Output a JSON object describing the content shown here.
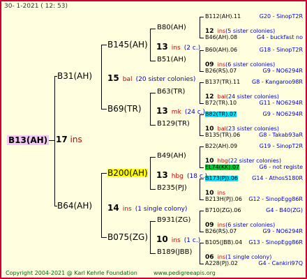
{
  "header": {
    "date": "30-  1-2021  ( 12:  53)"
  },
  "footer": {
    "copyright": "Copyright 2004-2021 @ Karl Kehrle Foundation",
    "site": "www.pedigreeapis.org"
  },
  "root": {
    "name": "B13(AH)",
    "number": "17",
    "suffix": "ins"
  },
  "gen1": [
    {
      "name": "B31(AH)",
      "number": "15",
      "suffix": "bal",
      "note": "(20 sister colonies)"
    },
    {
      "name": "B64(AH)",
      "number": "14",
      "suffix": "ins",
      "note": "(1 single colony)"
    }
  ],
  "gen2": [
    {
      "name": "B145(AH)",
      "number": "13",
      "suffix": "ins",
      "note": "(2 c.)"
    },
    {
      "name": "B69(TR)",
      "number": "13",
      "suffix": "mk",
      "note": "(24 c.)"
    },
    {
      "name": "B200(AH)",
      "number": "13",
      "suffix": "hbg",
      "note": "(18 c.)"
    },
    {
      "name": "B075(ZG)",
      "number": "10",
      "suffix": "ins",
      "note": "(1 c.)"
    }
  ],
  "gen3": [
    {
      "name": "B80(AH)",
      "number": "12",
      "suffix": "ins",
      "note": "(5 sister colonies)"
    },
    {
      "name": "B51(AH)",
      "number": "09",
      "suffix": "ins",
      "note": "(6 sister colonies)"
    },
    {
      "name": "B63(TR)",
      "number": "12",
      "suffix": "bal",
      "note": "(24 sister colonies)"
    },
    {
      "name": "B129(TR)",
      "number": "10",
      "suffix": "bal",
      "note": "(23 sister colonies)"
    },
    {
      "name": "B49(AH)",
      "number": "10",
      "suffix": "hbg",
      "note": "(22 sister colonies)"
    },
    {
      "name": "B235(PJ)",
      "number": "10",
      "suffix": "ins",
      "note": ""
    },
    {
      "name": "B931(ZG)",
      "number": "09",
      "suffix": "ins",
      "note": "(6 sister colonies)"
    },
    {
      "name": "B189(JBB)",
      "number": "06",
      "suffix": "ins",
      "note": "(1 single colony)"
    }
  ],
  "gen4": [
    {
      "name": "B112(AH).11",
      "code": "G20 - SinopT2R"
    },
    {
      "name": "B46(AH).08",
      "code": "G4 - buckfast no"
    },
    {
      "name": "B60(AH).06",
      "code": "G18 - SinopT2R"
    },
    {
      "name": "B26(RS).07",
      "code": "G9 - NO6294R"
    },
    {
      "name": "B137(TR).11",
      "code": "G8 - Kangaroo98R"
    },
    {
      "name": "B72(TR).10",
      "code": "G11 - NO6294R"
    },
    {
      "name": "B82(TR).07",
      "code": "G9 - NO6294R"
    },
    {
      "name": "B135(TR).06",
      "code": "G8 - Takab93aR"
    },
    {
      "name": "B22(AH).09",
      "code": "G19 - SinopT2R"
    },
    {
      "name": "EL74(KK).07",
      "code": "G6 - not registe"
    },
    {
      "name": "B173(PJ).06",
      "code": "G14 - AthosS180R"
    },
    {
      "name": "B213H(PJ).06",
      "code": "G12 - SinopEgg86R"
    },
    {
      "name": "B710(ZG).06",
      "code": "G4 - B40(ZG)"
    },
    {
      "name": "B26(RS).07",
      "code": "G9 - NO6294R"
    },
    {
      "name": "B105(JBB).04",
      "code": "G13 - SinopEgg86R"
    },
    {
      "name": "A228(PJ).02",
      "code": "G4 - Cankiri97Q"
    }
  ]
}
